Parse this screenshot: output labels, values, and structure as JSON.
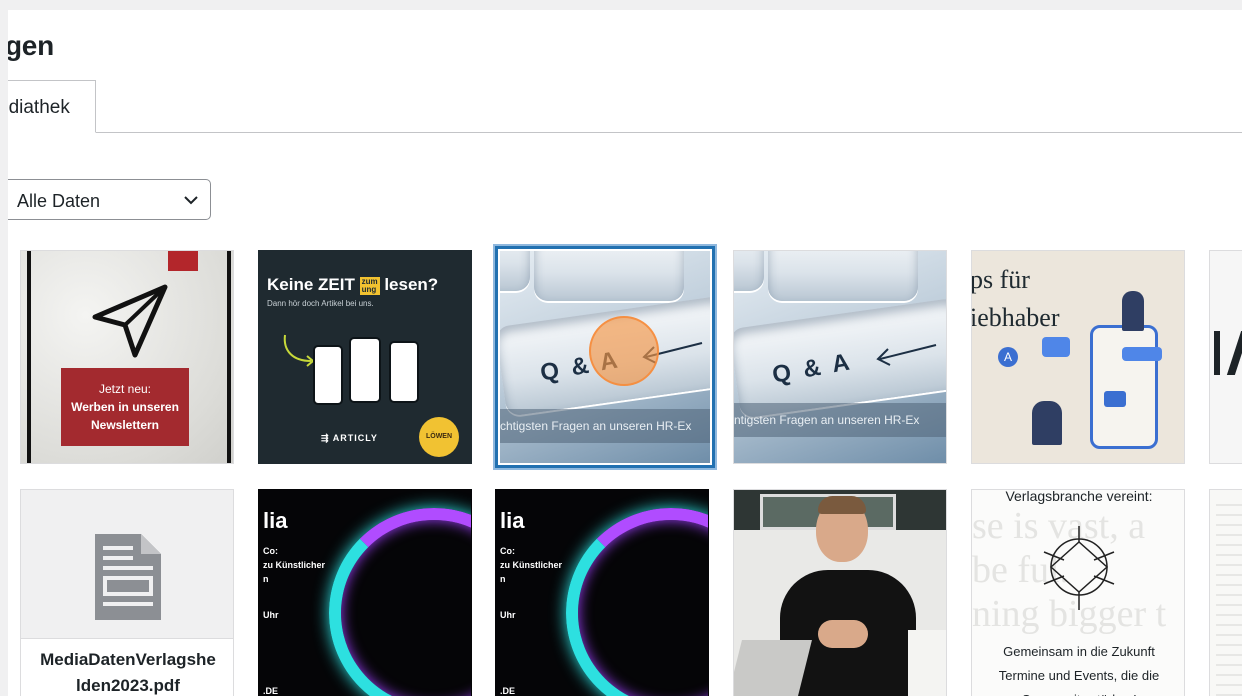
{
  "page": {
    "title": "gen"
  },
  "tabs": [
    {
      "label": "ediathek"
    }
  ],
  "filter": {
    "selected": "Alle Daten"
  },
  "tiles": {
    "t1": {
      "line1": "Jetzt neu:",
      "line2": "Werben in unseren",
      "line3": "Newslettern"
    },
    "t2": {
      "headline_a": "Keine ZEIT",
      "headline_sup1": "zum",
      "headline_sup2": "ung",
      "headline_b": "lesen?",
      "sub": "Dann hör doch Artikel bei uns.",
      "brand": "ARTICLY",
      "badge": "LÖWEN"
    },
    "t3": {
      "key_text": "Q & A",
      "caption": "chtigsten Fragen an unseren HR-Ex"
    },
    "t4": {
      "key_text": "Q & A",
      "caption": "ntigsten Fragen an unseren HR-Ex"
    },
    "t5": {
      "line1": "ps für",
      "line2": "iebhaber"
    },
    "t6": {
      "filename_1": "MediaDatenVerlagshe",
      "filename_2": "lden2023.pdf"
    },
    "t7": {
      "title": "lia",
      "l1": "Co:",
      "l2": "zu Künstlicher",
      "l3": "n",
      "l4": "Uhr",
      "l5": ".DE"
    },
    "t8": {
      "title": "lia",
      "l1": "Co:",
      "l2": "zu Künstlicher",
      "l3": "n",
      "l4": "Uhr",
      "l5": ".DE"
    },
    "t10": {
      "top": "Verlagsbranche vereint:",
      "bg1": "se is vast, a",
      "bg2": "be  ful.",
      "bg3": "ning bigger t",
      "l1": "Gemeinsam in die Zukunft",
      "l2": "Termine und Events, die die",
      "l3": "Community stärken!"
    }
  },
  "colors": {
    "selected_border": "#2271b1",
    "cursor": "#f5a05a",
    "banner_red": "#a32a2f",
    "dark_tile": "#1f2a30"
  }
}
